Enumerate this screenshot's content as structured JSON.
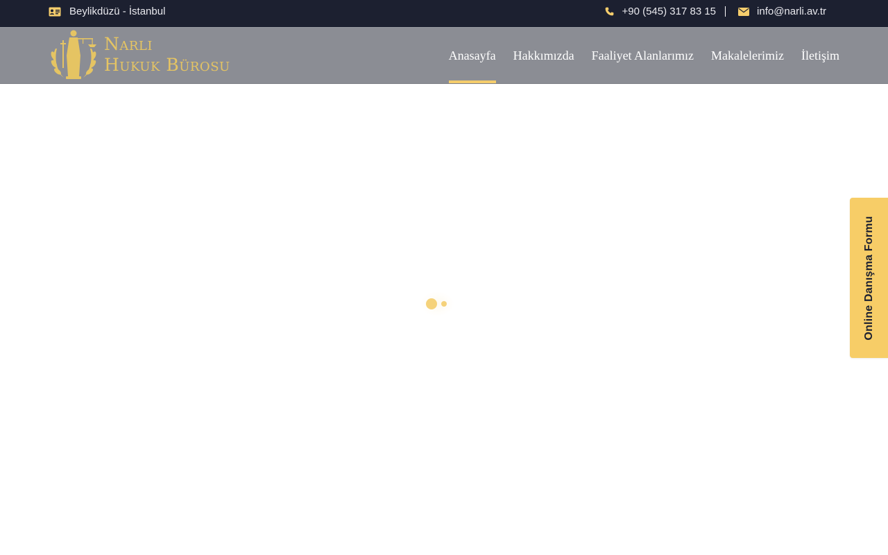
{
  "topbar": {
    "location": "Beylikdüzü - İstanbul",
    "phone": "+90 (545) 317 83 15",
    "email": "info@narli.av.tr",
    "icons": {
      "location": "id-card-icon",
      "phone": "phone-icon",
      "email": "envelope-icon"
    }
  },
  "header": {
    "brand_line1": "Narlı",
    "brand_line2": "Hukuk Bürosu",
    "logo_icon": "lady-justice-emblem",
    "menu": [
      {
        "label": "Anasayfa",
        "active": true
      },
      {
        "label": "Hakkımızda",
        "active": false
      },
      {
        "label": "Faaliyet Alanlarımız",
        "active": false
      },
      {
        "label": "Makalelerimiz",
        "active": false
      },
      {
        "label": "İletişim",
        "active": false
      }
    ]
  },
  "side_tab": {
    "label": "Online Danışma Formu"
  },
  "colors": {
    "topbar_bg": "#1c2030",
    "navbar_bg": "#8b8d94",
    "accent": "#f5cd6c",
    "brand_gold": "#e5c463"
  }
}
